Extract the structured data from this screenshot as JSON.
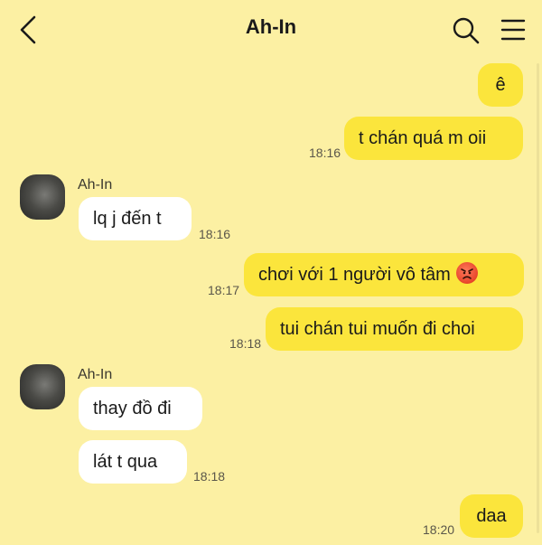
{
  "header": {
    "title": "Ah-In",
    "back_icon": "chevron-left-icon",
    "search_icon": "search-icon",
    "menu_icon": "hamburger-menu-icon"
  },
  "contact": {
    "name": "Ah-In"
  },
  "messages": [
    {
      "side": "out",
      "text": "ê",
      "time": ""
    },
    {
      "side": "out",
      "text": "t chán quá m oii",
      "time": "18:16"
    },
    {
      "side": "in",
      "text": "lq j đến t",
      "time": "18:16"
    },
    {
      "side": "out",
      "text": "chơi với 1 người vô tâm",
      "emoji": "angry-face-icon",
      "time": "18:17"
    },
    {
      "side": "out",
      "text": "tui chán tui muốn đi choi",
      "time": "18:18"
    },
    {
      "side": "in",
      "text": "thay đồ đi",
      "time": ""
    },
    {
      "side": "in",
      "text": "lát t qua",
      "time": "18:18"
    },
    {
      "side": "out",
      "text": "daa",
      "time": "18:20"
    }
  ],
  "colors": {
    "background": "#fcf0a3",
    "outgoing_bubble": "#fbe53c",
    "incoming_bubble": "#ffffff"
  }
}
